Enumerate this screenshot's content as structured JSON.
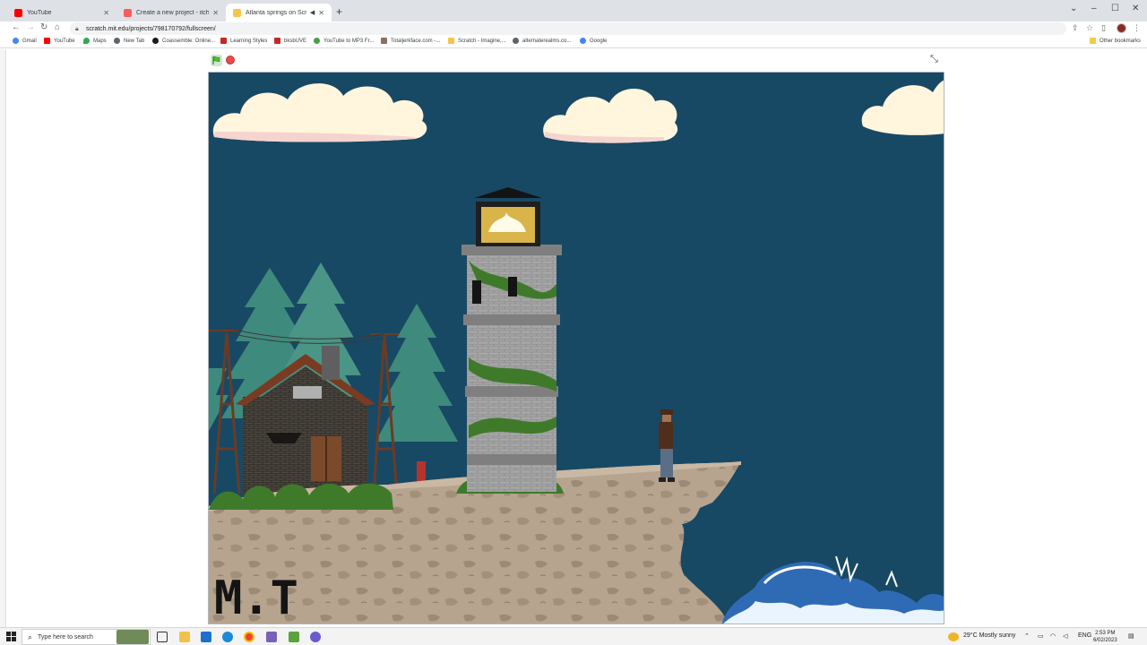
{
  "browser": {
    "tabs": [
      {
        "title": "YouTube",
        "color": "#ff0000"
      },
      {
        "title": "Create a new project - itch.io",
        "color": "#fa5c5c"
      },
      {
        "title": "Atlanta springs on Scratch",
        "color": "#f7c34c",
        "active": true
      }
    ],
    "url": "scratch.mit.edu/projects/798170792/fullscreen/",
    "bookmarks": [
      {
        "label": "Gmail",
        "icon": "google-icon",
        "color": "#4285f4"
      },
      {
        "label": "YouTube",
        "icon": "youtube-icon",
        "color": "#ff0000"
      },
      {
        "label": "Maps",
        "icon": "maps-pin-icon",
        "color": "#34a853"
      },
      {
        "label": "New Tab",
        "icon": "globe-icon",
        "color": "#5f6368"
      },
      {
        "label": "Coassemble: Online...",
        "icon": "coassemble-icon",
        "color": "#1a1a1a"
      },
      {
        "label": "Learning Styles",
        "icon": "grid-icon",
        "color": "#c62828"
      },
      {
        "label": "bksbUVE",
        "icon": "grid-icon",
        "color": "#c62828"
      },
      {
        "label": "YouTube to MP3 Fr...",
        "icon": "refresh-icon",
        "color": "#43a047"
      },
      {
        "label": "Totaljerkface.com -...",
        "icon": "site-icon",
        "color": "#8d6e63"
      },
      {
        "label": "Scratch - Imagine,...",
        "icon": "scratch-icon",
        "color": "#f7c34c"
      },
      {
        "label": "alternaterealms.co...",
        "icon": "globe-icon",
        "color": "#5f6368"
      },
      {
        "label": "Google",
        "icon": "google-icon",
        "color": "#4285f4"
      }
    ],
    "other_bookmarks": "Other bookmarks"
  },
  "scene": {
    "watermark": "M.T"
  },
  "taskbar": {
    "search_placeholder": "Type here to search",
    "weather": "29°C  Mostly sunny",
    "language": "ENG",
    "time": "2:53 PM",
    "date": "6/02/2023"
  }
}
